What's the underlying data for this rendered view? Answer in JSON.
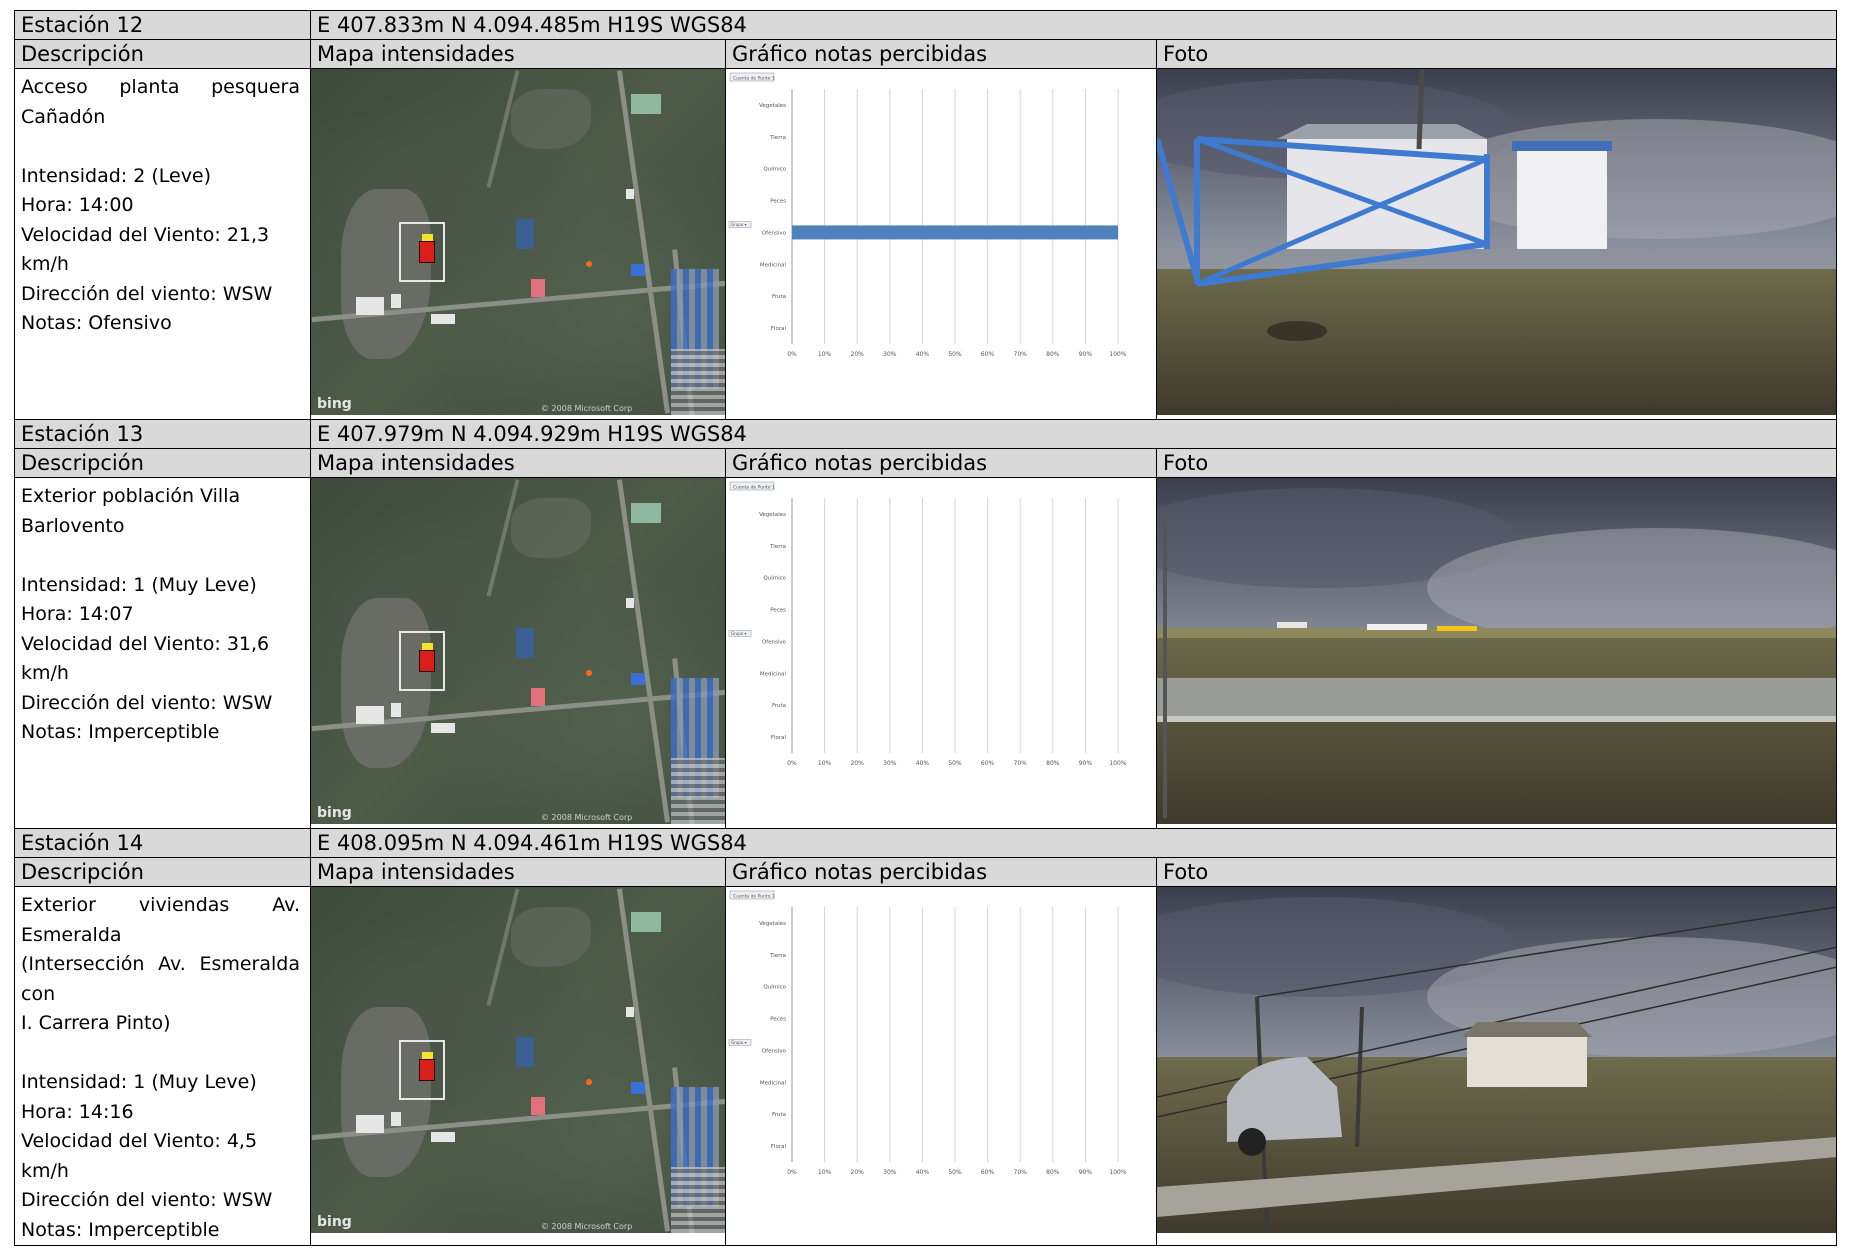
{
  "stations": [
    {
      "title": "Estación 12",
      "coords": "E 407.833m N 4.094.485m H19S WGS84",
      "headers": {
        "descripcion": "Descripción",
        "mapa": "Mapa intensidades",
        "grafico": "Gráfico notas percibidas",
        "foto": "Foto"
      },
      "description_lines": [
        "Acceso planta pesquera Cañadón"
      ],
      "intensidad": "Intensidad: 2 (Leve)",
      "hora": "Hora: 14:00",
      "velocidad": "Velocidad del Viento: 21,3 km/h",
      "direccion": "Dirección del viento: WSW",
      "notas": "Notas: Ofensivo",
      "map": {
        "logo": "bing",
        "copyright": "© 2008 Microsoft Corp"
      },
      "chart_data": {
        "type": "bar",
        "orientation": "horizontal",
        "field_button": "Cuenta de Punto 1",
        "filter_button": "Grupo",
        "categories": [
          "Vegetales",
          "Tierra",
          "Químico",
          "Peces",
          "Ofensivo",
          "Medicinal",
          "Fruta",
          "Floral"
        ],
        "values": [
          0,
          0,
          0,
          0,
          100,
          0,
          0,
          0
        ],
        "x_ticks": [
          "0%",
          "10%",
          "20%",
          "30%",
          "40%",
          "50%",
          "60%",
          "70%",
          "80%",
          "90%",
          "100%"
        ],
        "xlim": [
          0,
          100
        ],
        "bar_color": "#4f81bd",
        "grid": true
      }
    },
    {
      "title": "Estación 13",
      "coords": "E 407.979m N 4.094.929m H19S WGS84",
      "headers": {
        "descripcion": "Descripción",
        "mapa": "Mapa intensidades",
        "grafico": "Gráfico notas percibidas",
        "foto": "Foto"
      },
      "description_lines": [
        "Exterior población Villa",
        "Barlovento"
      ],
      "intensidad": "Intensidad: 1 (Muy Leve)",
      "hora": "Hora: 14:07",
      "velocidad": "Velocidad del Viento: 31,6 km/h",
      "direccion": "Dirección del viento: WSW",
      "notas": "Notas: Imperceptible",
      "map": {
        "logo": "bing",
        "copyright": "© 2008 Microsoft Corp"
      },
      "chart_data": {
        "type": "bar",
        "orientation": "horizontal",
        "field_button": "Cuenta de Punto 1",
        "filter_button": "Grupo",
        "categories": [
          "Vegetales",
          "Tierra",
          "Químico",
          "Peces",
          "Ofensivo",
          "Medicinal",
          "Fruta",
          "Floral"
        ],
        "values": [
          0,
          0,
          0,
          0,
          0,
          0,
          0,
          0
        ],
        "x_ticks": [
          "0%",
          "10%",
          "20%",
          "30%",
          "40%",
          "50%",
          "60%",
          "70%",
          "80%",
          "90%",
          "100%"
        ],
        "xlim": [
          0,
          100
        ],
        "bar_color": "#4f81bd",
        "grid": true
      }
    },
    {
      "title": "Estación 14",
      "coords": "E 408.095m N 4.094.461m H19S WGS84",
      "headers": {
        "descripcion": "Descripción",
        "mapa": "Mapa intensidades",
        "grafico": "Gráfico notas percibidas",
        "foto": "Foto"
      },
      "description_lines": [
        "Exterior viviendas Av. Esmeralda",
        "(Intersección Av. Esmeralda con",
        "I. Carrera Pinto)"
      ],
      "intensidad": "Intensidad: 1 (Muy Leve)",
      "hora": "Hora: 14:16",
      "velocidad": "Velocidad del Viento: 4,5 km/h",
      "direccion": "Dirección del viento: WSW",
      "notas": "Notas: Imperceptible",
      "map": {
        "logo": "bing",
        "copyright": "© 2008 Microsoft Corp"
      },
      "chart_data": {
        "type": "bar",
        "orientation": "horizontal",
        "field_button": "Cuenta de Punto 1",
        "filter_button": "Grupo",
        "categories": [
          "Vegetales",
          "Tierra",
          "Químico",
          "Peces",
          "Ofensivo",
          "Medicinal",
          "Fruta",
          "Floral"
        ],
        "values": [
          0,
          0,
          0,
          0,
          0,
          0,
          0,
          0
        ],
        "x_ticks": [
          "0%",
          "10%",
          "20%",
          "30%",
          "40%",
          "50%",
          "60%",
          "70%",
          "80%",
          "90%",
          "100%"
        ],
        "xlim": [
          0,
          100
        ],
        "bar_color": "#4f81bd",
        "grid": true
      }
    }
  ]
}
